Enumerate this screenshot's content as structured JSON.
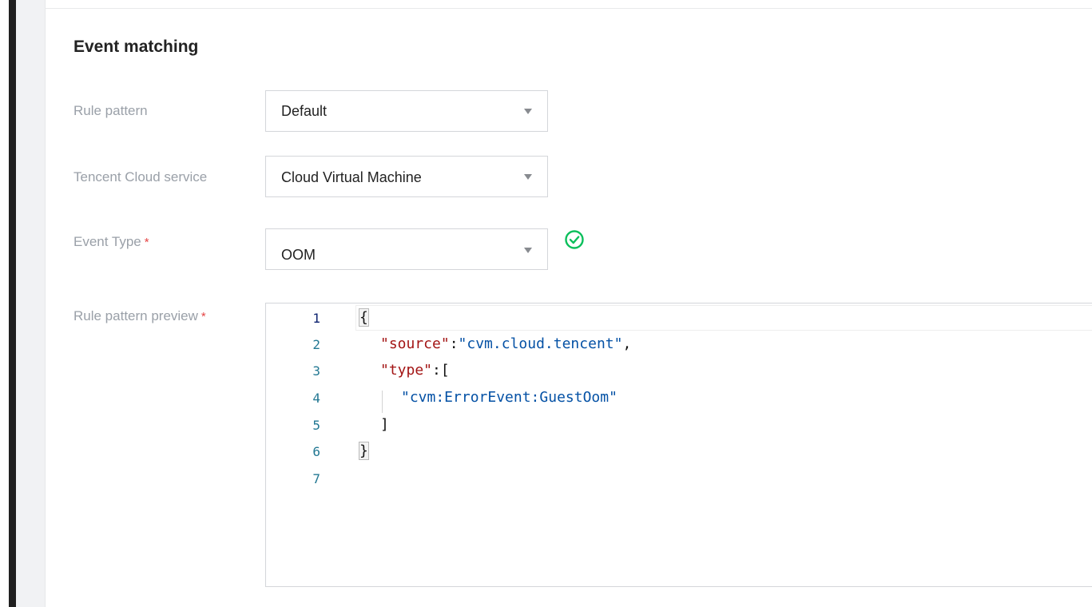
{
  "section": {
    "title": "Event matching"
  },
  "form": {
    "rule_pattern": {
      "label": "Rule pattern",
      "value": "Default"
    },
    "cloud_service": {
      "label": "Tencent Cloud service",
      "value": "Cloud Virtual Machine"
    },
    "event_type": {
      "label": "Event Type",
      "required_mark": "*",
      "value": "OOM",
      "status_icon": "check-circle-icon",
      "status_color": "#0abf5b"
    },
    "preview": {
      "label": "Rule pattern preview",
      "required_mark": "*"
    }
  },
  "editor": {
    "line_numbers": [
      "1",
      "2",
      "3",
      "4",
      "5",
      "6",
      "7"
    ],
    "lines": {
      "l1_brace": "{",
      "l2_key": "\"source\"",
      "l2_colon": ":",
      "l2_value": "\"cvm.cloud.tencent\"",
      "l2_comma": ",",
      "l3_key": "\"type\"",
      "l3_rest": ":[",
      "l4_value": "\"cvm:ErrorEvent:GuestOom\"",
      "l5_bracket": "]",
      "l6_brace": "}"
    }
  },
  "colors": {
    "json_key": "#a31515",
    "json_string": "#0451a5",
    "line_number": "#237893"
  }
}
